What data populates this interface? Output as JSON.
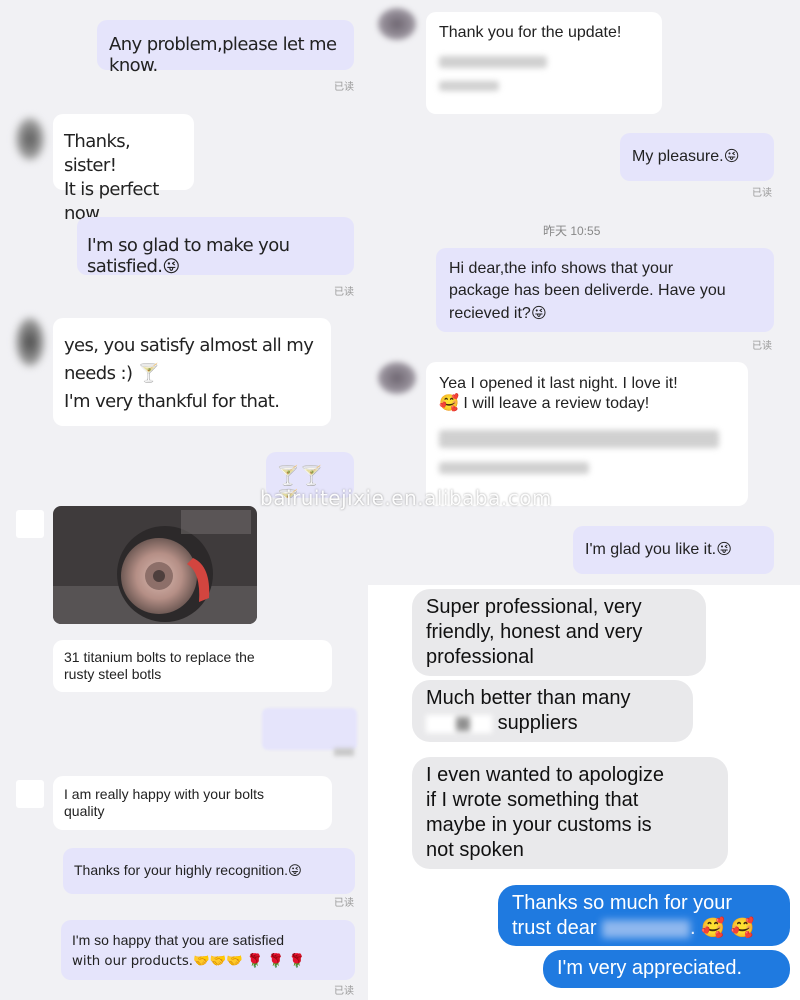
{
  "read_label": "已读",
  "watermark": "bairuitejixie.en.alibaba.com",
  "panel_top_left": {
    "msg1": "Any problem,please let me know.",
    "msg2_lines": [
      "Thanks, sister!",
      "It is perfect now"
    ],
    "msg3": "I'm so glad to make you satisfied.",
    "msg4_lines": [
      "yes, you satisfy almost all my",
      "needs :) 🍸",
      "I'm very thankful for that."
    ],
    "msg5": "🍸🍸🍸"
  },
  "panel_top_right": {
    "msg1": "Thank you for the update!",
    "msg2": "My pleasure.",
    "timestamp": "昨天 10:55",
    "msg3_lines": [
      "Hi dear,the info shows that your",
      "package has been deliverde. Have you",
      "recieved it?"
    ],
    "msg4_lines": [
      "Yea I opened it last night. I love it!",
      "🥰 I will leave a review today!"
    ],
    "msg5": "I'm glad you like it."
  },
  "panel_bottom_left": {
    "photo_caption_lines": [
      "31 titanium bolts to replace the",
      "rusty steel botls"
    ],
    "msg_quality_lines": [
      "I am really happy with your bolts",
      "quality"
    ],
    "msg_thanks": "Thanks for your highly recognition.",
    "msg_products_lines": [
      "I'm so happy that you are satisfied",
      "with our products.🤝🤝🤝 🌹 🌹 🌹"
    ]
  },
  "panel_bottom_right": {
    "msg1_lines": [
      "Super professional, very",
      "friendly, honest and very",
      "professional"
    ],
    "msg2_lines": [
      "Much better than many",
      "suppliers"
    ],
    "msg3_lines": [
      "I even wanted to apologize",
      "if I wrote something that",
      "maybe in your customs is",
      "not spoken"
    ],
    "msg4_lines": [
      "Thanks so much for your",
      "trust dear",
      "🥰 🥰"
    ],
    "msg5": "I'm very appreciated."
  },
  "emoji_wink": "😜",
  "colors": {
    "wechat_outgoing": "#e5e4fb",
    "wechat_incoming": "#ffffff",
    "chat_background": "#f1f1f4",
    "ig_incoming": "#e9e9eb",
    "ig_outgoing": "#1f7ae0"
  }
}
